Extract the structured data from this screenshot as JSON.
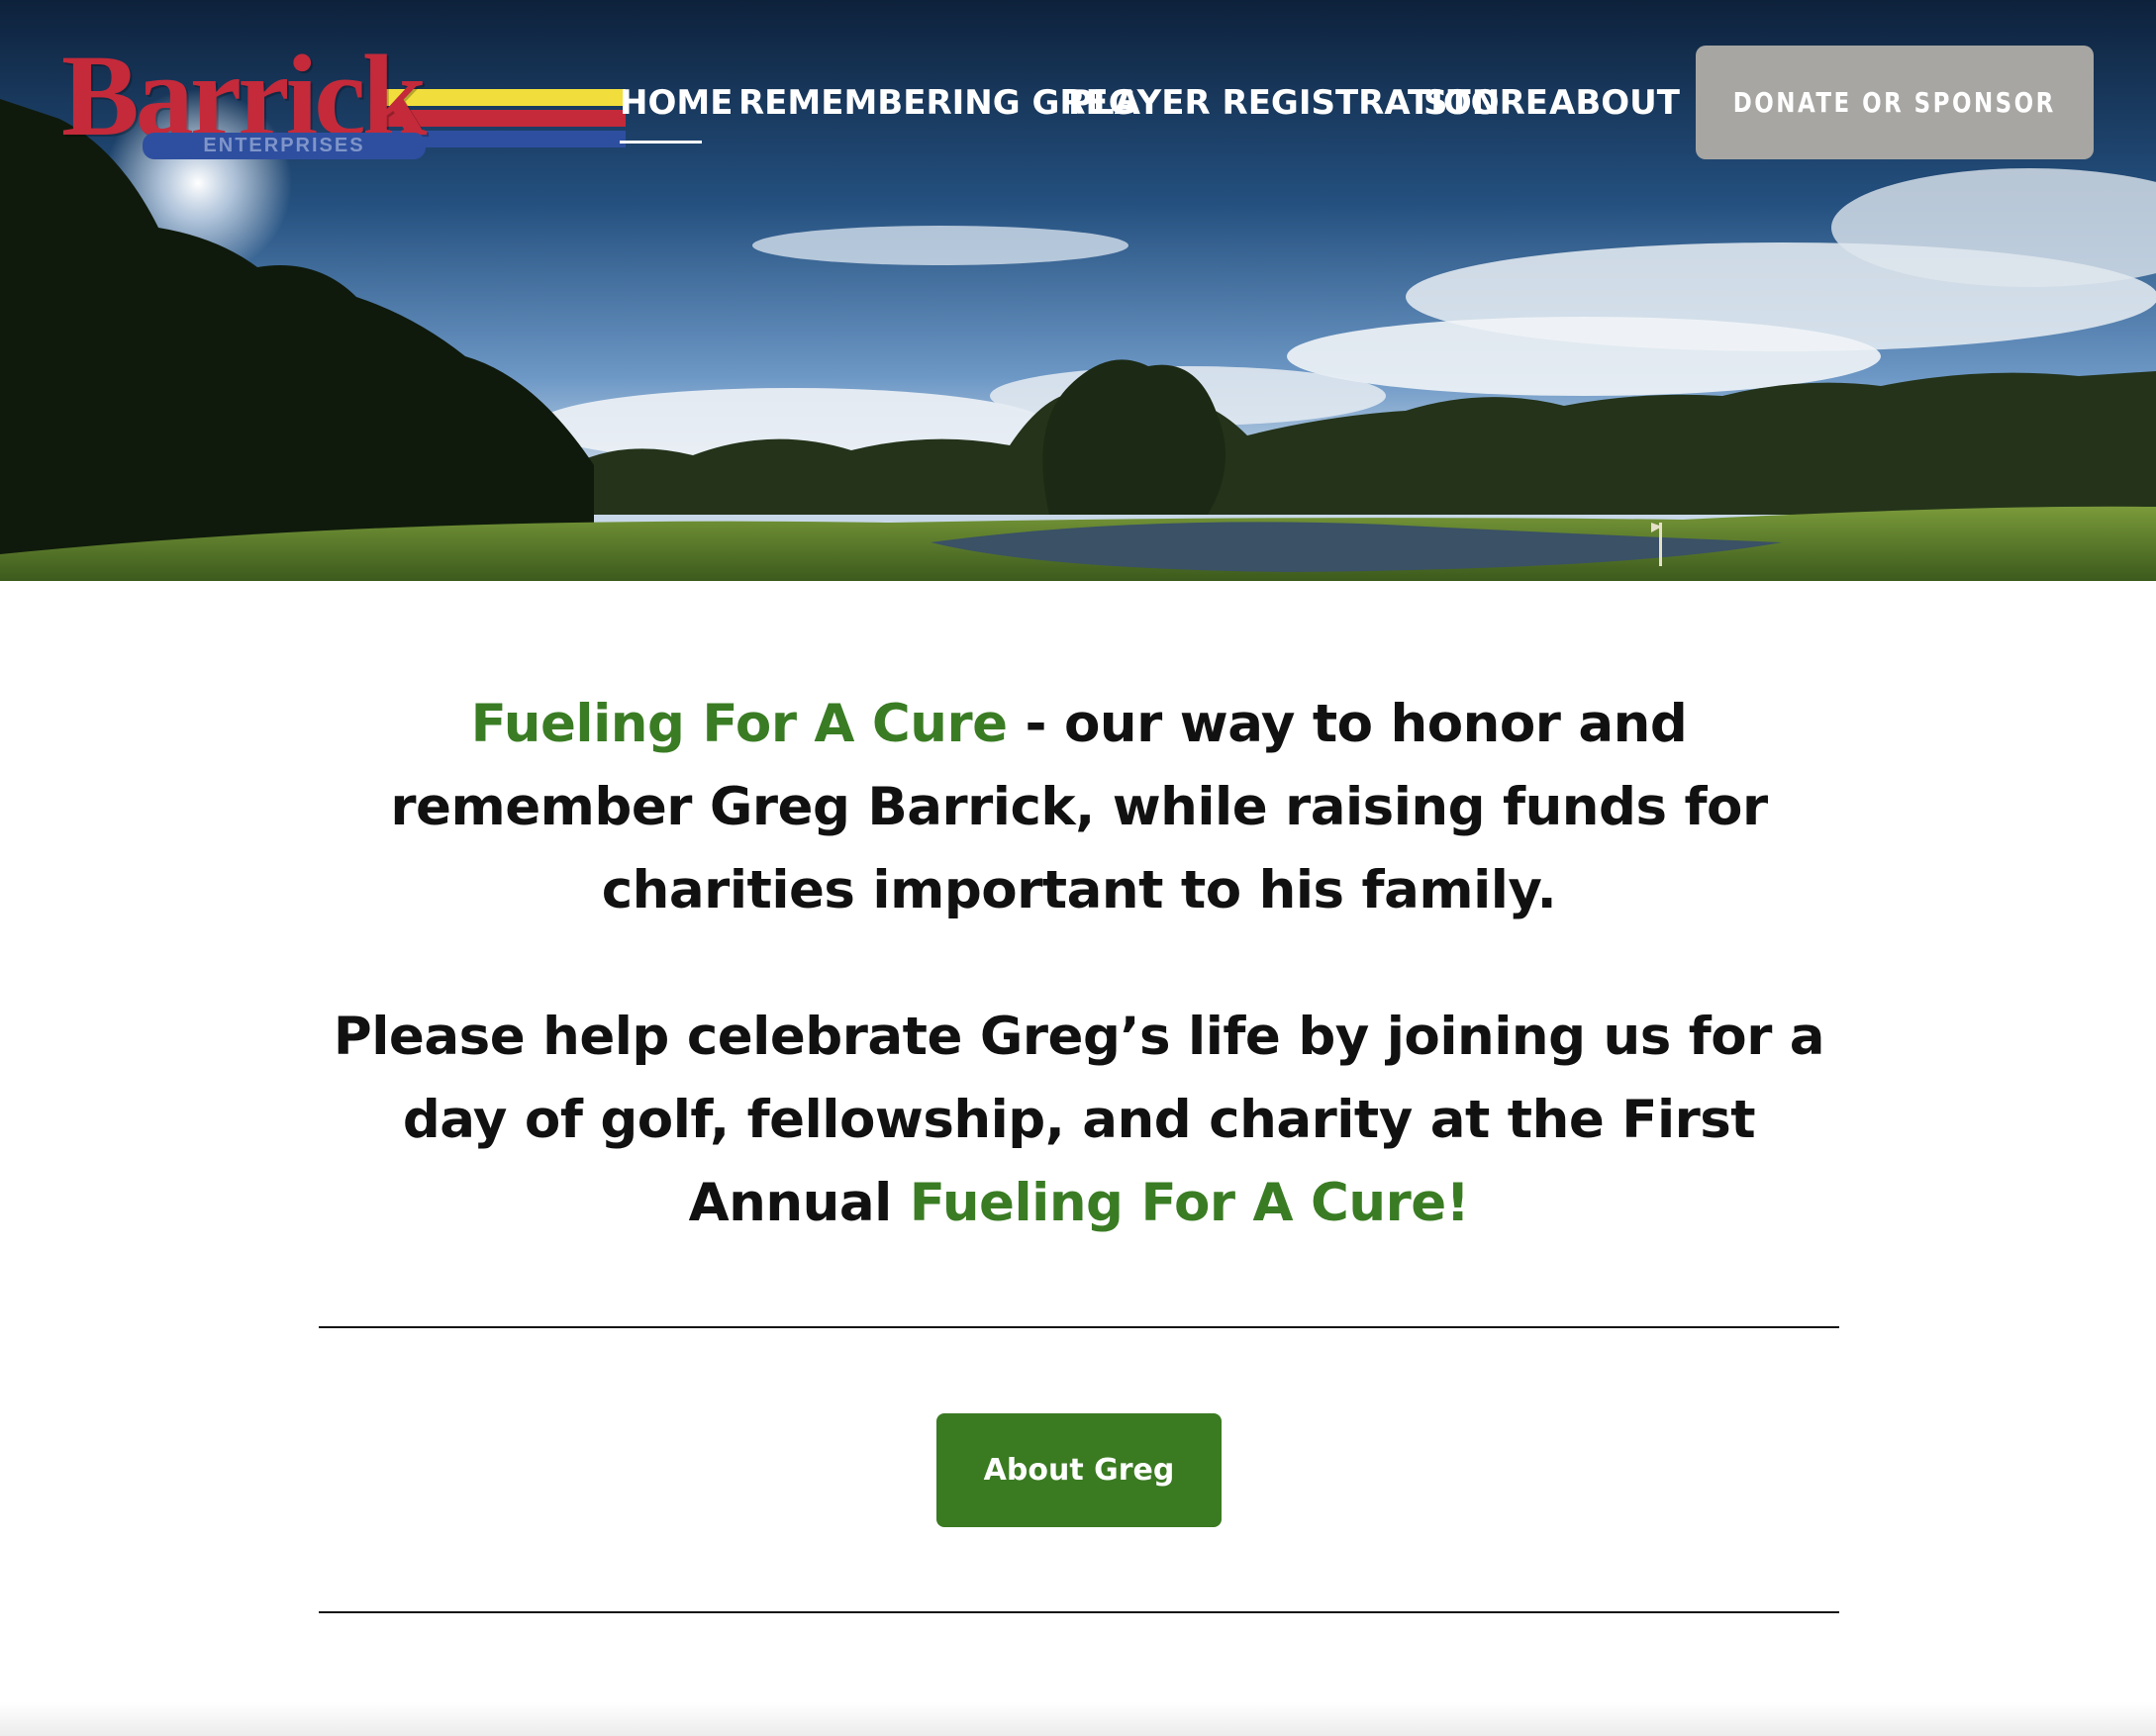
{
  "header": {
    "logo": {
      "wordmark": "Barrick",
      "subtitle": "ENTERPRISES"
    },
    "nav": [
      {
        "label": "HOME",
        "active": true
      },
      {
        "label": "REMEMBERING GREG"
      },
      {
        "label": "PLAYER REGISTRATION"
      },
      {
        "label": "STORE"
      },
      {
        "label": "ABOUT"
      }
    ],
    "donate_label": "DONATE OR SPONSOR"
  },
  "main": {
    "intro": {
      "highlight": "Fueling For A Cure",
      "text": " - our way to honor and remember Greg Barrick, while raising funds for charities important to his family."
    },
    "invite": {
      "text": "Please help celebrate Greg’s life by joining us for a day of golf, fellowship, and charity at the First Annual ",
      "highlight": "Fueling For A Cure!"
    },
    "about_button_label": "About Greg"
  },
  "colors": {
    "accent_green": "#3a7c24",
    "button_green": "#3a7a21",
    "donate_gray": "#a7a6a3",
    "logo_red": "#c42a3a",
    "logo_yellow": "#f1de3c",
    "logo_blue": "#2e4fa0"
  }
}
